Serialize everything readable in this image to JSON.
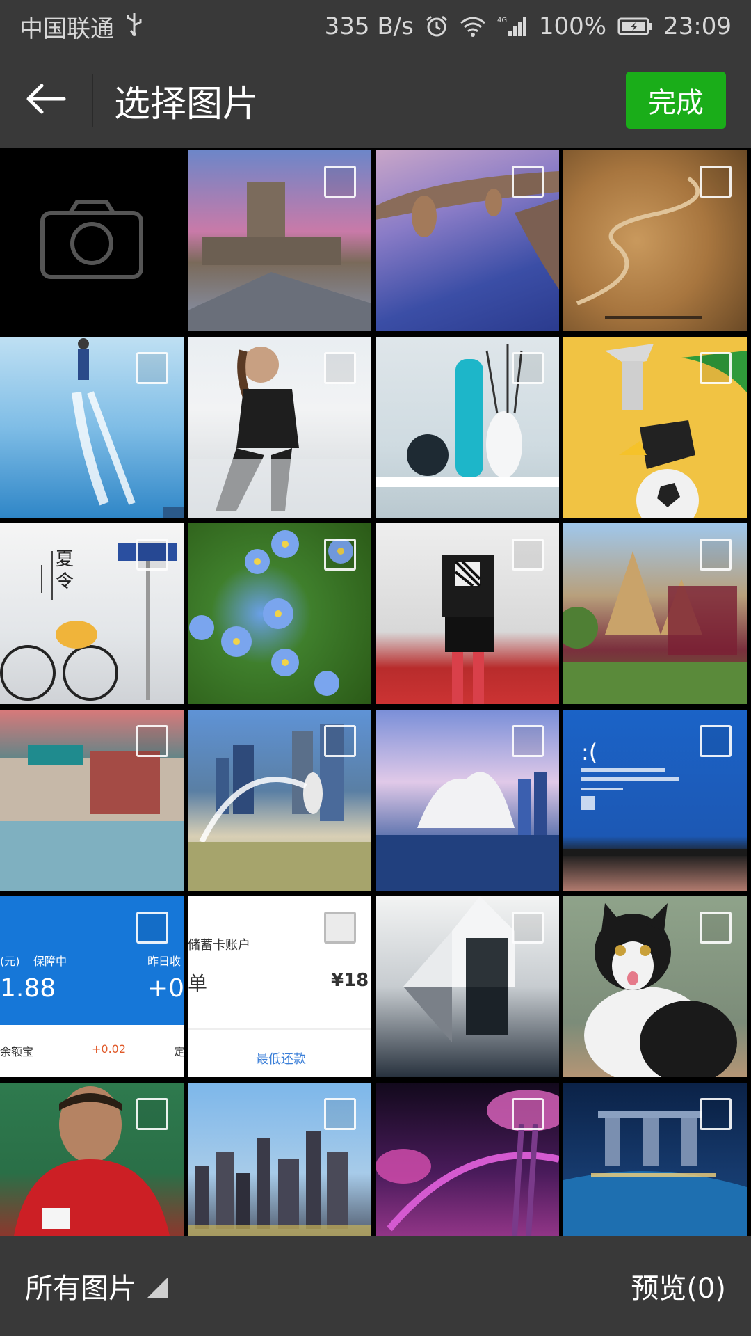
{
  "status_bar": {
    "carrier": "中国联通",
    "speed": "335 B/s",
    "battery": "100%",
    "time": "23:09",
    "icons": [
      "usb-icon",
      "alarm-icon",
      "wifi-icon",
      "4g-signal-icon",
      "battery-icon"
    ]
  },
  "title_bar": {
    "title": "选择图片",
    "done_label": "完成"
  },
  "grid": {
    "camera_icon": "camera-icon",
    "alipay_thumb": {
      "unit": "(元)",
      "status": "保障中",
      "right_label": "昨日收",
      "amount": "1.88",
      "right_amount": "+0",
      "bottom_left": "余额宝",
      "bottom_mid": "+0.02",
      "bottom_right": "定"
    },
    "bank_thumb": {
      "account": "储蓄卡账户",
      "left": "单",
      "right": "¥18",
      "button": "最低还款"
    }
  },
  "bottom_bar": {
    "album_label": "所有图片",
    "preview_label": "预览(0)"
  },
  "colors": {
    "bar_bg": "#393939",
    "accent_green": "#1aad19"
  }
}
